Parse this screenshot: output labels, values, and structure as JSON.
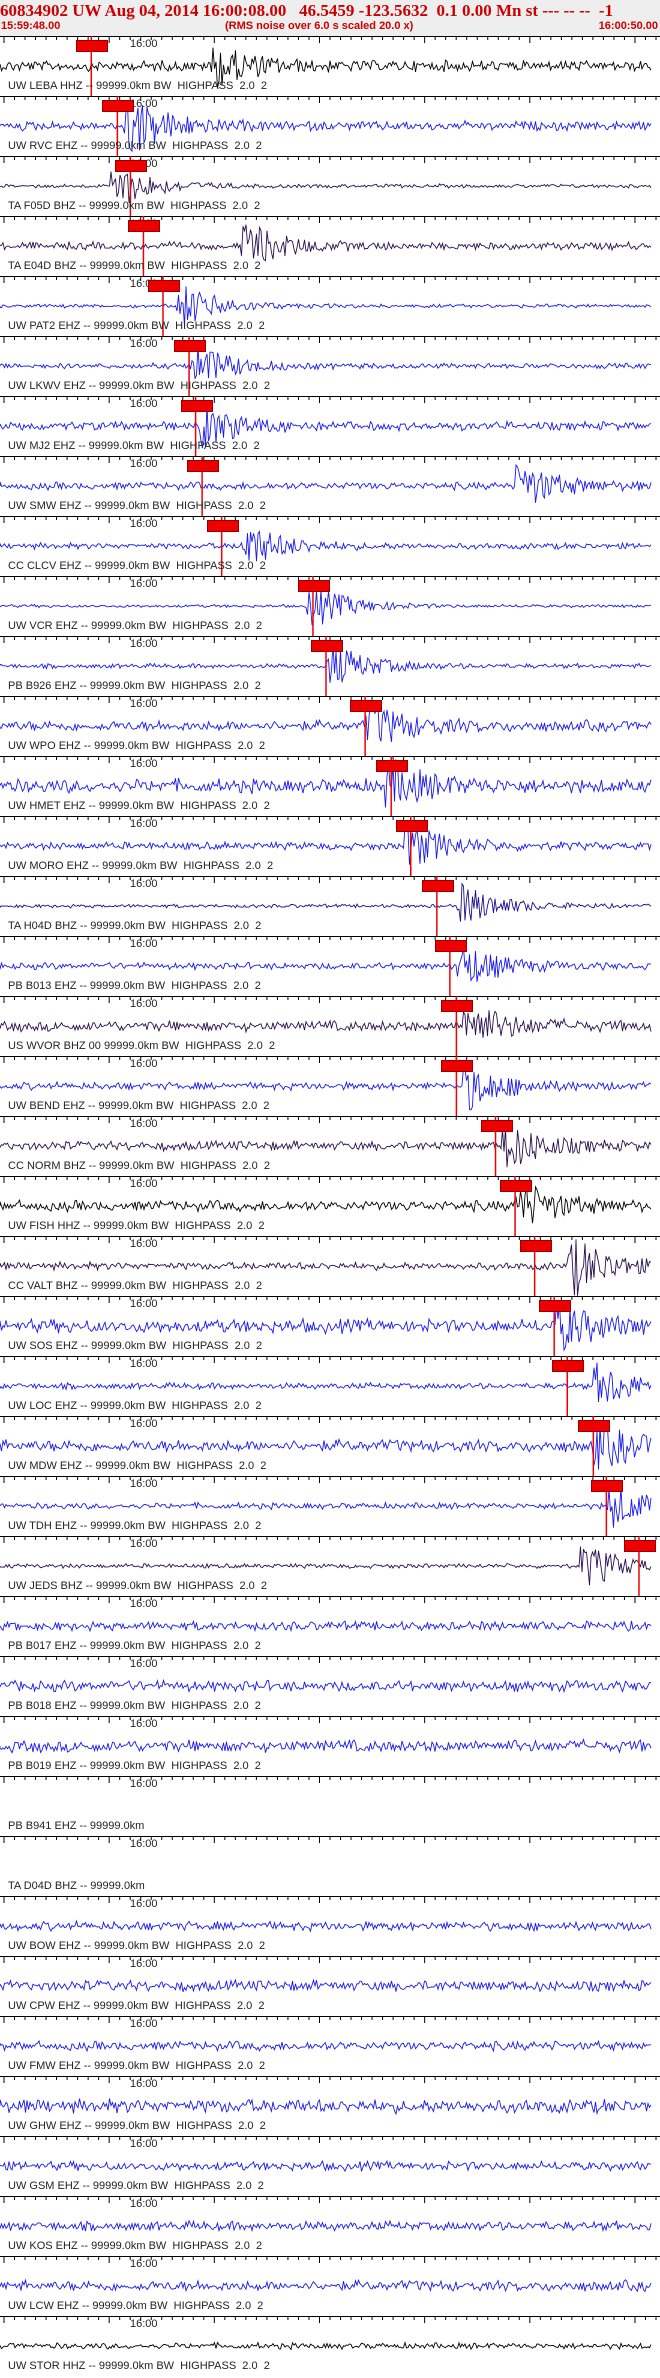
{
  "header": {
    "title": "60834902 UW Aug 04, 2014 16:00:08.00   46.5459 -123.5632  0.1 0.00 Mn st --- -- --  -1",
    "start_time": "15:59:48.00",
    "subtitle": "(RMS noise over 6.0 s scaled 20.0 x)",
    "end_time": "16:00:50.00"
  },
  "tick_label": "16:00",
  "colors": {
    "header_bg": "#eeeeee",
    "title": "#cc0000",
    "pick": "#ee0000",
    "blue": "#1a1aee",
    "black": "#000000",
    "purple": "#2a1050",
    "darkblue": "#1a1090"
  },
  "stations": [
    {
      "label": "UW LEBA HHZ -- 99999.0km BW  HIGHPASS  2.0  2",
      "color": "black",
      "amp": 0.35,
      "burst": 0.33,
      "pick": 0.14
    },
    {
      "label": "UW RVC EHZ -- 99999.0km BW  HIGHPASS  2.0  2",
      "color": "blue",
      "amp": 0.3,
      "burst": 0.2,
      "burstAmp": 1.6,
      "pick": 0.18
    },
    {
      "label": "TA F05D BHZ -- 99999.0km BW  HIGHPASS  2.0  2",
      "color": "purple",
      "amp": 0.12,
      "burst": 0.18,
      "pick": 0.2
    },
    {
      "label": "TA E04D BHZ -- 99999.0km BW  HIGHPASS  2.0  2",
      "color": "purple",
      "amp": 0.25,
      "burst": 0.38,
      "pick": 0.22
    },
    {
      "label": "UW PAT2 EHZ -- 99999.0km BW  HIGHPASS  2.0  2",
      "color": "blue",
      "amp": 0.12,
      "burst": 0.28,
      "pick": 0.25
    },
    {
      "label": "UW LKWV EHZ -- 99999.0km BW  HIGHPASS  2.0  2",
      "color": "blue",
      "amp": 0.18,
      "burst": 0.3,
      "pick": 0.29
    },
    {
      "label": "UW MJ2 EHZ -- 99999.0km BW  HIGHPASS  2.0  2",
      "color": "blue",
      "amp": 0.28,
      "burst": 0.31,
      "pick": 0.3
    },
    {
      "label": "UW SMW EHZ -- 99999.0km BW  HIGHPASS  2.0  2",
      "color": "blue",
      "amp": 0.25,
      "burst": 0.8,
      "pick": 0.31
    },
    {
      "label": "CC CLCV EHZ -- 99999.0km BW  HIGHPASS  2.0  2",
      "color": "blue",
      "amp": 0.2,
      "burst": 0.38,
      "pick": 0.34
    },
    {
      "label": "UW VCR EHZ -- 99999.0km BW  HIGHPASS  2.0  2",
      "color": "blue",
      "amp": 0.1,
      "burst": 0.48,
      "pick": 0.48
    },
    {
      "label": "PB B926 EHZ -- 99999.0km BW  HIGHPASS  2.0  2",
      "color": "blue",
      "amp": 0.15,
      "burst": 0.51,
      "pick": 0.5
    },
    {
      "label": "UW WPO EHZ -- 99999.0km BW  HIGHPASS  2.0  2",
      "color": "blue",
      "amp": 0.35,
      "burst": 0.57,
      "pick": 0.56
    },
    {
      "label": "UW HMET EHZ -- 99999.0km BW  HIGHPASS  2.0  2",
      "color": "blue",
      "amp": 0.45,
      "burst": 0.6,
      "pick": 0.6
    },
    {
      "label": "UW MORO EHZ -- 99999.0km BW  HIGHPASS  2.0  2",
      "color": "blue",
      "amp": 0.25,
      "burst": 0.63,
      "pick": 0.63
    },
    {
      "label": "TA H04D BHZ -- 99999.0km BW  HIGHPASS  2.0  2",
      "color": "darkblue",
      "amp": 0.12,
      "burst": 0.71,
      "pick": 0.67
    },
    {
      "label": "PB B013 EHZ -- 99999.0km BW  HIGHPASS  2.0  2",
      "color": "blue",
      "amp": 0.22,
      "burst": 0.71,
      "pick": 0.69
    },
    {
      "label": "US WVOR BHZ 00 99999.0km BW  HIGHPASS  2.0  2",
      "color": "purple",
      "amp": 0.35,
      "burst": 0.72,
      "pick": 0.7
    },
    {
      "label": "UW BEND EHZ -- 99999.0km BW  HIGHPASS  2.0  2",
      "color": "blue",
      "amp": 0.25,
      "burst": 0.72,
      "pick": 0.7
    },
    {
      "label": "CC NORM BHZ -- 99999.0km BW  HIGHPASS  2.0  2",
      "color": "purple",
      "amp": 0.3,
      "burst": 0.78,
      "pick": 0.76
    },
    {
      "label": "UW FISH HHZ -- 99999.0km BW  HIGHPASS  2.0  2",
      "color": "black",
      "amp": 0.35,
      "burst": 0.8,
      "pick": 0.79
    },
    {
      "label": "CC VALT BHZ -- 99999.0km BW  HIGHPASS  2.0  2",
      "color": "purple",
      "amp": 0.25,
      "burst": 0.88,
      "burstAmp": 1.6,
      "pick": 0.82
    },
    {
      "label": "UW SOS EHZ -- 99999.0km BW  HIGHPASS  2.0  2",
      "color": "blue",
      "amp": 0.45,
      "burst": 0.86,
      "pick": 0.85
    },
    {
      "label": "UW LOC EHZ -- 99999.0km BW  HIGHPASS  2.0  2",
      "color": "blue",
      "amp": 0.2,
      "burst": 0.92,
      "pick": 0.87
    },
    {
      "label": "UW MDW EHZ -- 99999.0km BW  HIGHPASS  2.0  2",
      "color": "blue",
      "amp": 0.4,
      "burst": 0.92,
      "pick": 0.91
    },
    {
      "label": "UW TDH EHZ -- 99999.0km BW  HIGHPASS  2.0  2",
      "color": "blue",
      "amp": 0.2,
      "burst": 0.94,
      "pick": 0.93
    },
    {
      "label": "UW JEDS BHZ -- 99999.0km BW  HIGHPASS  2.0  2",
      "color": "purple",
      "amp": 0.15,
      "burst": 0.9,
      "pick": 0.98
    },
    {
      "label": "PB B017 EHZ -- 99999.0km BW  HIGHPASS  2.0  2",
      "color": "blue",
      "amp": 0.3,
      "burst": null,
      "pick": null
    },
    {
      "label": "PB B018 EHZ -- 99999.0km BW  HIGHPASS  2.0  2",
      "color": "blue",
      "amp": 0.35,
      "burst": null,
      "pick": null
    },
    {
      "label": "PB B019 EHZ -- 99999.0km BW  HIGHPASS  2.0  2",
      "color": "blue",
      "amp": 0.4,
      "burst": null,
      "pick": null
    },
    {
      "label": "PB B941 EHZ -- 99999.0km",
      "color": "blue",
      "amp": 0.0,
      "burst": null,
      "pick": null
    },
    {
      "label": "TA D04D BHZ -- 99999.0km",
      "color": "blue",
      "amp": 0.0,
      "burst": null,
      "pick": null
    },
    {
      "label": "UW BOW EHZ -- 99999.0km BW  HIGHPASS  2.0  2",
      "color": "blue",
      "amp": 0.3,
      "burst": null,
      "pick": null
    },
    {
      "label": "UW CPW EHZ -- 99999.0km BW  HIGHPASS  2.0  2",
      "color": "blue",
      "amp": 0.35,
      "burst": null,
      "pick": null
    },
    {
      "label": "UW FMW EHZ -- 99999.0km BW  HIGHPASS  2.0  2",
      "color": "blue",
      "amp": 0.3,
      "burst": null,
      "pick": null
    },
    {
      "label": "UW GHW EHZ -- 99999.0km BW  HIGHPASS  2.0  2",
      "color": "blue",
      "amp": 0.45,
      "burst": null,
      "pick": null
    },
    {
      "label": "UW GSM EHZ -- 99999.0km BW  HIGHPASS  2.0  2",
      "color": "blue",
      "amp": 0.3,
      "burst": null,
      "pick": null
    },
    {
      "label": "UW KOS EHZ -- 99999.0km BW  HIGHPASS  2.0  2",
      "color": "blue",
      "amp": 0.3,
      "burst": null,
      "pick": null
    },
    {
      "label": "UW LCW EHZ -- 99999.0km BW  HIGHPASS  2.0  2",
      "color": "blue",
      "amp": 0.35,
      "burst": null,
      "pick": null
    },
    {
      "label": "UW STOR HHZ -- 99999.0km BW  HIGHPASS  2.0  2",
      "color": "black",
      "amp": 0.2,
      "burst": null,
      "pick": null
    }
  ]
}
